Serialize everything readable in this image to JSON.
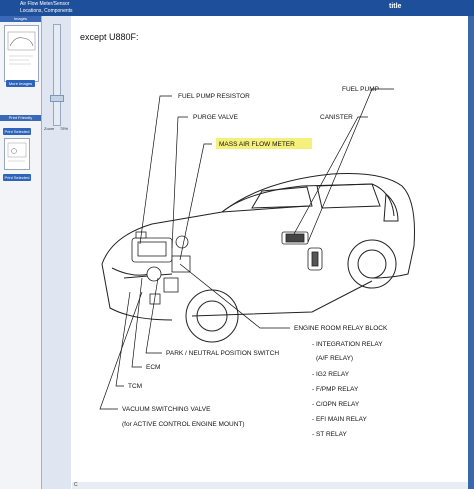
{
  "window": {
    "title_line1": "Air Flow Meter/Sensor",
    "title_line2": "Locations, Components",
    "right_label": "title"
  },
  "sidebar": {
    "images_header": "Images",
    "more_images": "More Images",
    "print_friendly": "Print Friendly",
    "print_selected_1": "Print Selected",
    "print_selected_2": "Print Selected"
  },
  "zoom": {
    "label": "Zoom",
    "value": "75%",
    "level_fraction": 0.74
  },
  "diagram": {
    "heading": "except U880F:",
    "labels": {
      "fuel_pump_resistor": "FUEL PUMP RESISTOR",
      "purge_valve": "PURGE VALVE",
      "mass_air_flow_meter": "MASS AIR FLOW METER",
      "fuel_pump": "FUEL PUMP",
      "canister": "CANISTER",
      "engine_room_relay_block": "ENGINE ROOM RELAY BLOCK",
      "integration_relay": "- INTEGRATION RELAY",
      "af_relay": "(A/F RELAY)",
      "ig2_relay": "- IG2 RELAY",
      "fpmp_relay": "- F/PMP RELAY",
      "copn_relay": "- C/OPN RELAY",
      "efi_main_relay": "- EFI MAIN RELAY",
      "st_relay": "- ST RELAY",
      "park_neutral_switch": "PARK / NEUTRAL POSITION SWITCH",
      "ecm": "ECM",
      "tcm": "TCM",
      "vacuum_switching_valve": "VACUUM SWITCHING VALVE",
      "vsv_note": "(for ACTIVE CONTROL ENGINE MOUNT)"
    },
    "highlight_color": "#f5f07a"
  },
  "footer": {
    "corner_mark": "C"
  },
  "colors": {
    "title_bar": "#1e4f9a",
    "accent": "#2d63b8"
  }
}
